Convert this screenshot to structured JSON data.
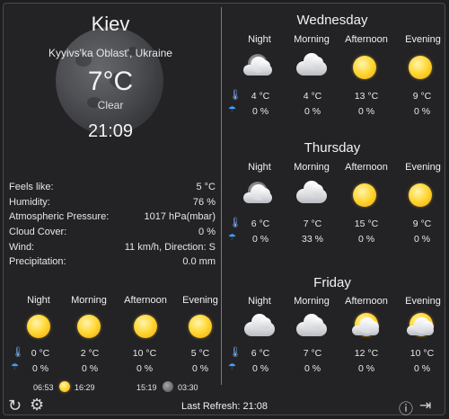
{
  "location": {
    "city": "Kiev",
    "region": "Kyyivs'ka Oblast', Ukraine",
    "temperature": "7°C",
    "condition": "Clear",
    "time": "21:09"
  },
  "details": [
    {
      "label": "Feels like:",
      "value": "5 °C"
    },
    {
      "label": "Humidity:",
      "value": "76 %"
    },
    {
      "label": "Atmospheric Pressure:",
      "value": "1017 hPa(mbar)"
    },
    {
      "label": "Cloud Cover:",
      "value": "0 %"
    },
    {
      "label": "Wind:",
      "value": "11 km/h, Direction: S"
    },
    {
      "label": "Precipitation:",
      "value": "0.0 mm"
    }
  ],
  "periods": [
    "Night",
    "Morning",
    "Afternoon",
    "Evening"
  ],
  "today": {
    "icons": [
      "sun-icon",
      "sun-icon",
      "sun-icon",
      "sun-icon"
    ],
    "temps": [
      "0 °C",
      "2 °C",
      "10 °C",
      "5 °C"
    ],
    "precip": [
      "0 %",
      "0 %",
      "0 %",
      "0 %"
    ],
    "sunrise": "06:53",
    "sunset": "16:29",
    "moonrise": "15:19",
    "moonset": "03:30"
  },
  "forecast": [
    {
      "day": "Wednesday",
      "icons": [
        "moon-cloud-icon",
        "cloud-icon",
        "sun-icon",
        "sun-icon"
      ],
      "temps": [
        "4 °C",
        "4 °C",
        "13 °C",
        "9 °C"
      ],
      "precip": [
        "0 %",
        "0 %",
        "0 %",
        "0 %"
      ]
    },
    {
      "day": "Thursday",
      "icons": [
        "moon-cloud-icon",
        "cloud-icon",
        "sun-icon",
        "sun-icon"
      ],
      "temps": [
        "6 °C",
        "7 °C",
        "15 °C",
        "9 °C"
      ],
      "precip": [
        "0 %",
        "33 %",
        "0 %",
        "0 %"
      ]
    },
    {
      "day": "Friday",
      "icons": [
        "cloud-icon",
        "cloud-icon",
        "sun-cloud-icon",
        "sun-cloud-icon"
      ],
      "temps": [
        "6 °C",
        "7 °C",
        "12 °C",
        "10 °C"
      ],
      "precip": [
        "0 %",
        "0 %",
        "0 %",
        "0 %"
      ]
    }
  ],
  "footer": {
    "last_refresh": "Last Refresh: 21:08"
  }
}
